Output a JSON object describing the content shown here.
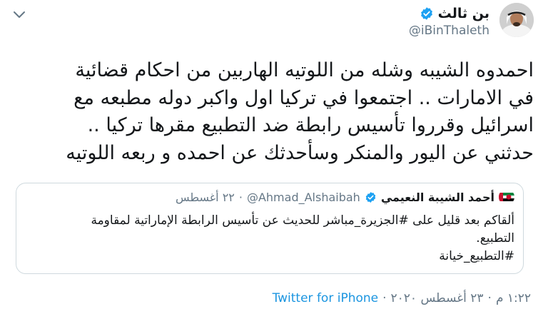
{
  "tweet": {
    "display_name": "بن ثالث",
    "handle": "@iBinThaleth",
    "text_lines": [
      "احمدوه الشيبه وشله من اللوتيه الهاربين من احكام قضائية",
      "في الامارات .. اجتمعوا في تركيا اول واكبر دوله مطبعه مع",
      "اسرائيل وقرروا تأسيس رابطة ضد التطبيع مقرها تركيا ..",
      "حدثني عن اليور والمنكر وسأحدثك عن احمده و ربعه اللوتيه"
    ],
    "time": "١:٢٢ م",
    "date": "٢٣ أغسطس ٢٠٢٠",
    "separator": "·",
    "source": "Twitter for iPhone"
  },
  "quoted": {
    "display_name": "أحمد الشيبة النعيمي",
    "handle": "@Ahmad_Alshaibah",
    "separator": "·",
    "date": "٢٢ أغسطس",
    "text_lines": [
      "ألقاكم بعد قليل على #الجزيرة_مباشر للحديث عن تأسيس الرابطة الإماراتية لمقاومة",
      "التطبيع.",
      "#التطبيع_خيانة"
    ]
  },
  "colors": {
    "verified": "#1da1f2",
    "link": "#1b95e0",
    "muted": "#657786"
  },
  "icons": {
    "menu": "chevron-down-icon",
    "verified": "verified-badge-icon"
  }
}
